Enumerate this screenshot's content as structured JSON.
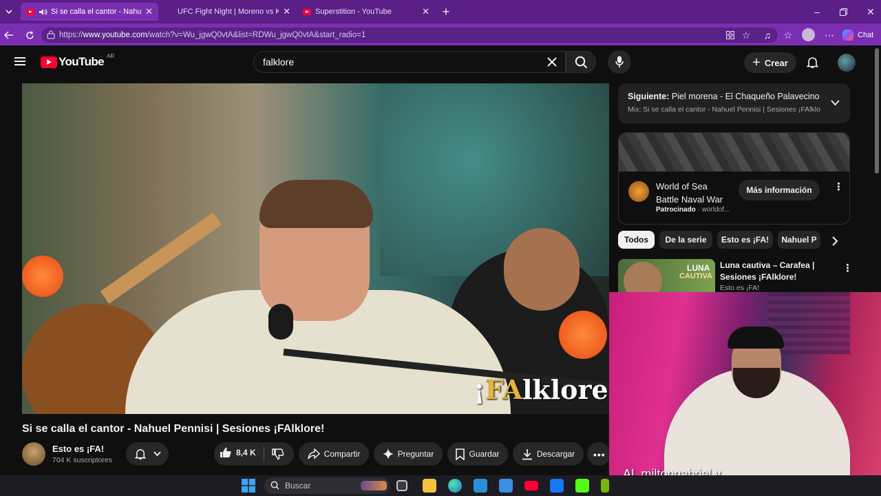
{
  "browser": {
    "tabs": [
      {
        "title": "Si se calla el cantor - Nahuel P",
        "active": true
      },
      {
        "title": "UFC Fight Night | Moreno vs Kava",
        "active": false
      },
      {
        "title": "Superstition - YouTube",
        "active": false
      }
    ],
    "url_prefix": "https://",
    "url_host": "www.youtube.com",
    "url_rest": "/watch?v=Wu_jgwQ0vtA&list=RDWu_jgwQ0vtA&start_radio=1",
    "chat_label": "Chat"
  },
  "youtube": {
    "logo_text": "YouTube",
    "region": "AR",
    "search_value": "falklore",
    "create_label": "Crear"
  },
  "video": {
    "overlay_logo_prefix": "¡",
    "overlay_logo_gold": "FA",
    "overlay_logo_rest": "lklore!",
    "title": "Si se calla el cantor - Nahuel Pennisi | Sesiones ¡FAlklore!",
    "channel_name": "Esto es ¡FA!",
    "subscribers": "704 K suscriptores",
    "likes": "8,4 K",
    "share_label": "Compartir",
    "ask_label": "Preguntar",
    "save_label": "Guardar",
    "download_label": "Descargar"
  },
  "up_next": {
    "prefix": "Siguiente:",
    "title": "Piel morena - El Chaqueño Palavecino | ...",
    "mix": "Mix: Si se calla el cantor - Nahuel Pennisi | Sesiones ¡FAlklore"
  },
  "ad": {
    "title_line1": "World of Sea",
    "title_line2": "Battle Naval War",
    "sponsored": "Patrocinado",
    "advertiser": "worldof...",
    "cta": "Más información"
  },
  "chips": [
    "Todos",
    "De la serie",
    "Esto es ¡FA!",
    "Nahuel P"
  ],
  "related": [
    {
      "thumb_text_1": "LUNA",
      "thumb_text_2": "CAUTIVA",
      "title_line1": "Luna cautiva – Carafea |",
      "title_line2": "Sesiones ¡FAlklore!",
      "channel": "Esto es ¡FA!"
    }
  ],
  "webcam": {
    "overlay_text": "AL  miltongabriel.v"
  },
  "taskbar": {
    "search_placeholder": "Buscar"
  },
  "colors": {
    "browser_tabbar": "#5b1f88",
    "browser_addressbar": "#7a2fb3",
    "youtube_bg": "#0f0f0f",
    "youtube_red": "#ff0033"
  }
}
